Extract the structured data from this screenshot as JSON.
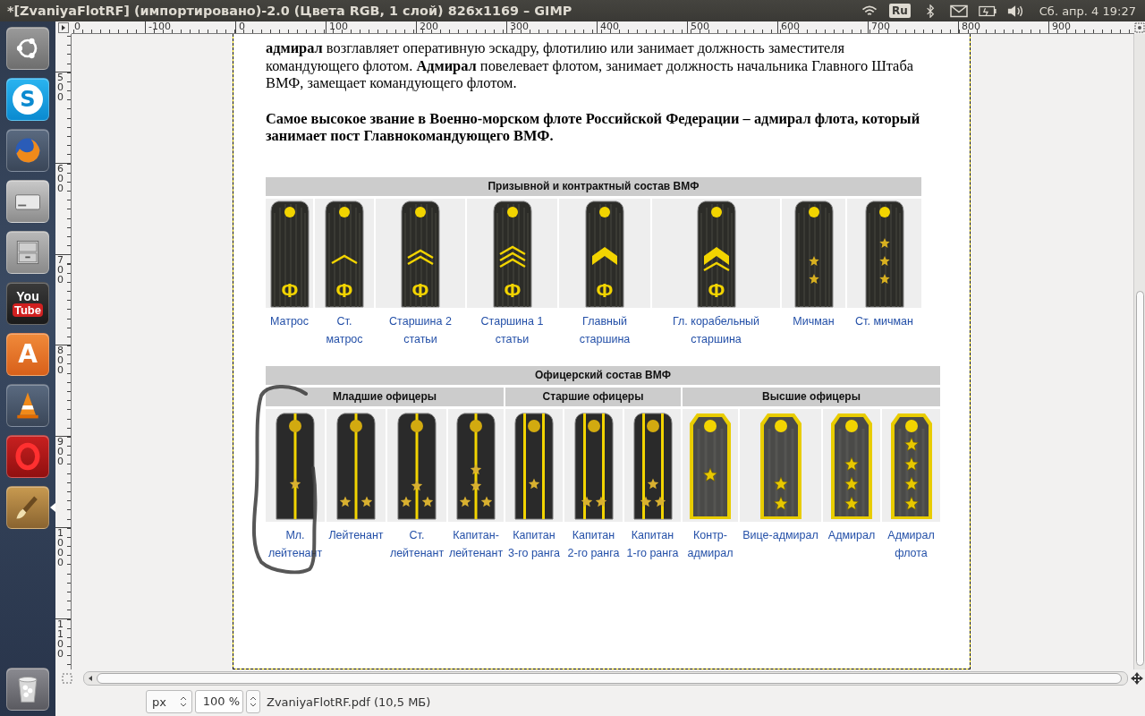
{
  "window": {
    "title": "*[ZvaniyaFlotRF] (импортировано)-2.0 (Цвета RGB, 1 слой) 826x1169 – GIMP"
  },
  "top_panel": {
    "keyboard_layout": "Ru",
    "clock": "Сб. апр. 4 19:27"
  },
  "launcher": {
    "items": [
      {
        "kind": "ubuntu",
        "focused": false
      },
      {
        "kind": "skype",
        "glyphs": [
          "S"
        ],
        "focused": false
      },
      {
        "kind": "browser",
        "focused": false
      },
      {
        "kind": "drive",
        "focused": false
      },
      {
        "kind": "cabinet",
        "focused": false
      },
      {
        "kind": "video",
        "glyphs": [
          "You",
          "Tube"
        ],
        "focused": false
      },
      {
        "kind": "store",
        "glyphs": [
          "A"
        ],
        "focused": false
      },
      {
        "kind": "cone",
        "focused": false
      },
      {
        "kind": "ring",
        "focused": false
      },
      {
        "kind": "brush",
        "focused": true
      }
    ],
    "trash": {
      "kind": "trash"
    }
  },
  "rulers": {
    "horizontal": [
      "0",
      "-100",
      "0",
      "100",
      "200",
      "300",
      "400",
      "500",
      "600",
      "700",
      "800",
      "900"
    ],
    "vertical": [
      "500",
      "600",
      "700",
      "800",
      "900",
      "1000",
      "1100"
    ]
  },
  "document": {
    "paragraphs": [
      {
        "kind": "normal",
        "text": "**адмирал** возглавляет оперативную эскадру, флотилию или занимает должность заместителя командующего флотом. **Адмирал** повелевает флотом, занимает должность начальника Главного Штаба ВМФ, замещает командующего флотом."
      },
      {
        "kind": "bold",
        "text": "Самое высокое звание в Военно-морском флоте Российской Федерации – адмирал флота, который занимает пост Главнокомандующего ВМФ."
      }
    ],
    "enlisted_table": {
      "title": "Призывной и контрактный состав ВМФ",
      "ranks": [
        {
          "label": "Матрос",
          "kind": "plain",
          "emblem": "Ф"
        },
        {
          "label": "Ст. матрос",
          "kind": "single",
          "emblem": "Ф"
        },
        {
          "label": "Старшина 2 статьи",
          "kind": "double",
          "emblem": "Ф"
        },
        {
          "label": "Старшина 1 статьи",
          "kind": "triple",
          "emblem": "Ф"
        },
        {
          "label": "Главный старшина",
          "kind": "broad",
          "emblem": "Ф"
        },
        {
          "label": "Гл. корабельный старшина",
          "kind": "broadplus",
          "emblem": "Ф"
        },
        {
          "label": "Мичман",
          "kind": "twostar"
        },
        {
          "label": "Ст. мичман",
          "kind": "threestar"
        }
      ]
    },
    "officer_table": {
      "title": "Офицерский состав ВМФ",
      "groups": [
        {
          "title": "Младшие офицеры",
          "ranks": [
            {
              "label": "Мл. лейтенант",
              "kind": "junior1"
            },
            {
              "label": "Лейтенант",
              "kind": "junior2"
            },
            {
              "label": "Ст. лейтенант",
              "kind": "junior3"
            },
            {
              "label": "Капитан-лейтенант",
              "kind": "junior4"
            }
          ]
        },
        {
          "title": "Старшие офицеры",
          "ranks": [
            {
              "label": "Капитан 3-го ранга",
              "kind": "senior1"
            },
            {
              "label": "Капитан 2-го ранга",
              "kind": "senior2"
            },
            {
              "label": "Капитан 1-го ранга",
              "kind": "senior3"
            }
          ]
        },
        {
          "title": "Высшие офицеры",
          "ranks": [
            {
              "label": "Контр-адмирал",
              "kind": "flag1"
            },
            {
              "label": "Вице-адмирал",
              "kind": "flag2"
            },
            {
              "label": "Адмирал",
              "kind": "flag3"
            },
            {
              "label": "Адмирал флота",
              "kind": "flag4"
            }
          ]
        }
      ]
    }
  },
  "status_bar": {
    "unit": "px",
    "zoom": "100 %",
    "file": "ZvaniyaFlotRF.pdf (10,5 МБ)"
  }
}
